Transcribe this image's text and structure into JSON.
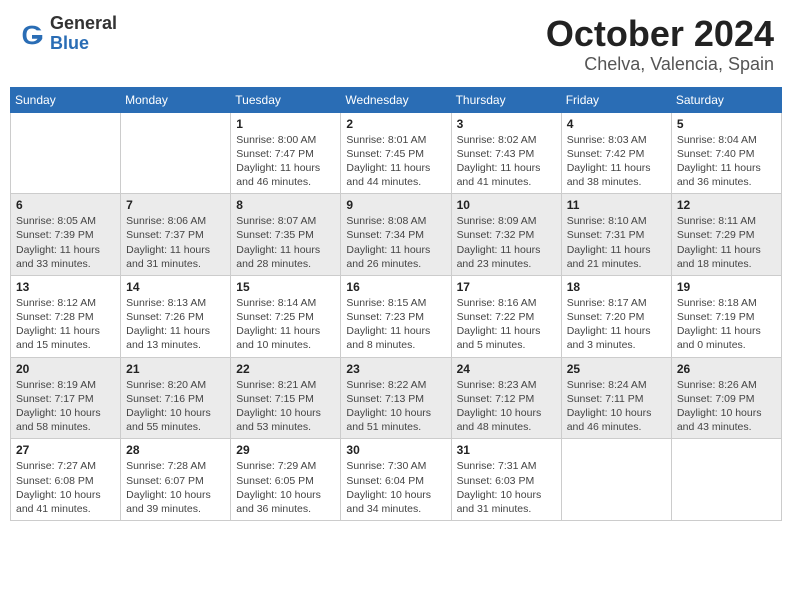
{
  "header": {
    "logo_general": "General",
    "logo_blue": "Blue",
    "month_title": "October 2024",
    "location": "Chelva, Valencia, Spain"
  },
  "days_of_week": [
    "Sunday",
    "Monday",
    "Tuesday",
    "Wednesday",
    "Thursday",
    "Friday",
    "Saturday"
  ],
  "weeks": [
    [
      {
        "day": "",
        "info": ""
      },
      {
        "day": "",
        "info": ""
      },
      {
        "day": "1",
        "sunrise": "Sunrise: 8:00 AM",
        "sunset": "Sunset: 7:47 PM",
        "daylight": "Daylight: 11 hours and 46 minutes."
      },
      {
        "day": "2",
        "sunrise": "Sunrise: 8:01 AM",
        "sunset": "Sunset: 7:45 PM",
        "daylight": "Daylight: 11 hours and 44 minutes."
      },
      {
        "day": "3",
        "sunrise": "Sunrise: 8:02 AM",
        "sunset": "Sunset: 7:43 PM",
        "daylight": "Daylight: 11 hours and 41 minutes."
      },
      {
        "day": "4",
        "sunrise": "Sunrise: 8:03 AM",
        "sunset": "Sunset: 7:42 PM",
        "daylight": "Daylight: 11 hours and 38 minutes."
      },
      {
        "day": "5",
        "sunrise": "Sunrise: 8:04 AM",
        "sunset": "Sunset: 7:40 PM",
        "daylight": "Daylight: 11 hours and 36 minutes."
      }
    ],
    [
      {
        "day": "6",
        "sunrise": "Sunrise: 8:05 AM",
        "sunset": "Sunset: 7:39 PM",
        "daylight": "Daylight: 11 hours and 33 minutes."
      },
      {
        "day": "7",
        "sunrise": "Sunrise: 8:06 AM",
        "sunset": "Sunset: 7:37 PM",
        "daylight": "Daylight: 11 hours and 31 minutes."
      },
      {
        "day": "8",
        "sunrise": "Sunrise: 8:07 AM",
        "sunset": "Sunset: 7:35 PM",
        "daylight": "Daylight: 11 hours and 28 minutes."
      },
      {
        "day": "9",
        "sunrise": "Sunrise: 8:08 AM",
        "sunset": "Sunset: 7:34 PM",
        "daylight": "Daylight: 11 hours and 26 minutes."
      },
      {
        "day": "10",
        "sunrise": "Sunrise: 8:09 AM",
        "sunset": "Sunset: 7:32 PM",
        "daylight": "Daylight: 11 hours and 23 minutes."
      },
      {
        "day": "11",
        "sunrise": "Sunrise: 8:10 AM",
        "sunset": "Sunset: 7:31 PM",
        "daylight": "Daylight: 11 hours and 21 minutes."
      },
      {
        "day": "12",
        "sunrise": "Sunrise: 8:11 AM",
        "sunset": "Sunset: 7:29 PM",
        "daylight": "Daylight: 11 hours and 18 minutes."
      }
    ],
    [
      {
        "day": "13",
        "sunrise": "Sunrise: 8:12 AM",
        "sunset": "Sunset: 7:28 PM",
        "daylight": "Daylight: 11 hours and 15 minutes."
      },
      {
        "day": "14",
        "sunrise": "Sunrise: 8:13 AM",
        "sunset": "Sunset: 7:26 PM",
        "daylight": "Daylight: 11 hours and 13 minutes."
      },
      {
        "day": "15",
        "sunrise": "Sunrise: 8:14 AM",
        "sunset": "Sunset: 7:25 PM",
        "daylight": "Daylight: 11 hours and 10 minutes."
      },
      {
        "day": "16",
        "sunrise": "Sunrise: 8:15 AM",
        "sunset": "Sunset: 7:23 PM",
        "daylight": "Daylight: 11 hours and 8 minutes."
      },
      {
        "day": "17",
        "sunrise": "Sunrise: 8:16 AM",
        "sunset": "Sunset: 7:22 PM",
        "daylight": "Daylight: 11 hours and 5 minutes."
      },
      {
        "day": "18",
        "sunrise": "Sunrise: 8:17 AM",
        "sunset": "Sunset: 7:20 PM",
        "daylight": "Daylight: 11 hours and 3 minutes."
      },
      {
        "day": "19",
        "sunrise": "Sunrise: 8:18 AM",
        "sunset": "Sunset: 7:19 PM",
        "daylight": "Daylight: 11 hours and 0 minutes."
      }
    ],
    [
      {
        "day": "20",
        "sunrise": "Sunrise: 8:19 AM",
        "sunset": "Sunset: 7:17 PM",
        "daylight": "Daylight: 10 hours and 58 minutes."
      },
      {
        "day": "21",
        "sunrise": "Sunrise: 8:20 AM",
        "sunset": "Sunset: 7:16 PM",
        "daylight": "Daylight: 10 hours and 55 minutes."
      },
      {
        "day": "22",
        "sunrise": "Sunrise: 8:21 AM",
        "sunset": "Sunset: 7:15 PM",
        "daylight": "Daylight: 10 hours and 53 minutes."
      },
      {
        "day": "23",
        "sunrise": "Sunrise: 8:22 AM",
        "sunset": "Sunset: 7:13 PM",
        "daylight": "Daylight: 10 hours and 51 minutes."
      },
      {
        "day": "24",
        "sunrise": "Sunrise: 8:23 AM",
        "sunset": "Sunset: 7:12 PM",
        "daylight": "Daylight: 10 hours and 48 minutes."
      },
      {
        "day": "25",
        "sunrise": "Sunrise: 8:24 AM",
        "sunset": "Sunset: 7:11 PM",
        "daylight": "Daylight: 10 hours and 46 minutes."
      },
      {
        "day": "26",
        "sunrise": "Sunrise: 8:26 AM",
        "sunset": "Sunset: 7:09 PM",
        "daylight": "Daylight: 10 hours and 43 minutes."
      }
    ],
    [
      {
        "day": "27",
        "sunrise": "Sunrise: 7:27 AM",
        "sunset": "Sunset: 6:08 PM",
        "daylight": "Daylight: 10 hours and 41 minutes."
      },
      {
        "day": "28",
        "sunrise": "Sunrise: 7:28 AM",
        "sunset": "Sunset: 6:07 PM",
        "daylight": "Daylight: 10 hours and 39 minutes."
      },
      {
        "day": "29",
        "sunrise": "Sunrise: 7:29 AM",
        "sunset": "Sunset: 6:05 PM",
        "daylight": "Daylight: 10 hours and 36 minutes."
      },
      {
        "day": "30",
        "sunrise": "Sunrise: 7:30 AM",
        "sunset": "Sunset: 6:04 PM",
        "daylight": "Daylight: 10 hours and 34 minutes."
      },
      {
        "day": "31",
        "sunrise": "Sunrise: 7:31 AM",
        "sunset": "Sunset: 6:03 PM",
        "daylight": "Daylight: 10 hours and 31 minutes."
      },
      {
        "day": "",
        "info": ""
      },
      {
        "day": "",
        "info": ""
      }
    ]
  ]
}
